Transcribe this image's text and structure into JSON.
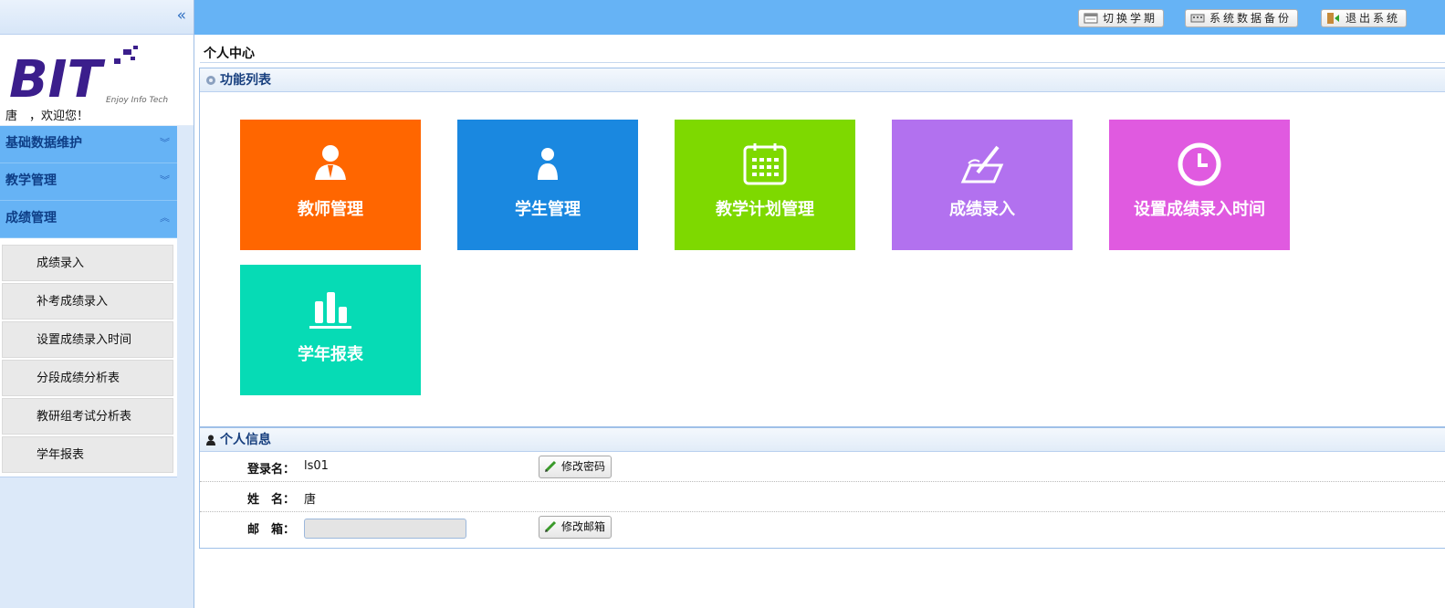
{
  "sidebar": {
    "collapse_glyph": "«",
    "logo_text": "BIT",
    "logo_tagline": "Enjoy Info Tech",
    "welcome": "唐　，欢迎您！",
    "menus": [
      {
        "label": "基础数据维护",
        "expanded": false
      },
      {
        "label": "教学管理",
        "expanded": false
      },
      {
        "label": "成绩管理",
        "expanded": true
      }
    ],
    "submenu": [
      "成绩录入",
      "补考成绩录入",
      "设置成绩录入时间",
      "分段成绩分析表",
      "教研组考试分析表",
      "学年报表"
    ]
  },
  "topbar": {
    "buttons": [
      {
        "label": "切换学期",
        "icon": "calendar-icon"
      },
      {
        "label": "系统数据备份",
        "icon": "keyboard-icon"
      },
      {
        "label": "退出系统",
        "icon": "exit-door-icon"
      }
    ]
  },
  "main": {
    "page_title": "个人中心",
    "func_panel_title": "功能列表",
    "tiles": [
      {
        "label": "教师管理",
        "color": "#ff6600",
        "icon": "teacher-icon"
      },
      {
        "label": "学生管理",
        "color": "#1a88e0",
        "icon": "student-icon"
      },
      {
        "label": "教学计划管理",
        "color": "#7ed900",
        "icon": "calendar-icon"
      },
      {
        "label": "成绩录入",
        "color": "#b271ef",
        "icon": "pen-tablet-icon"
      },
      {
        "label": "设置成绩录入时间",
        "color": "#e05ae0",
        "icon": "clock-icon"
      },
      {
        "label": "学年报表",
        "color": "#06dbb5",
        "icon": "bar-chart-icon"
      }
    ],
    "info_panel_title": "个人信息",
    "info": {
      "login_label": "登录名：",
      "login_value": "ls01",
      "name_label": "姓　名：",
      "name_value": "唐",
      "email_label": "邮　箱：",
      "email_value": "",
      "change_password": "修改密码",
      "change_email": "修改邮箱"
    }
  }
}
